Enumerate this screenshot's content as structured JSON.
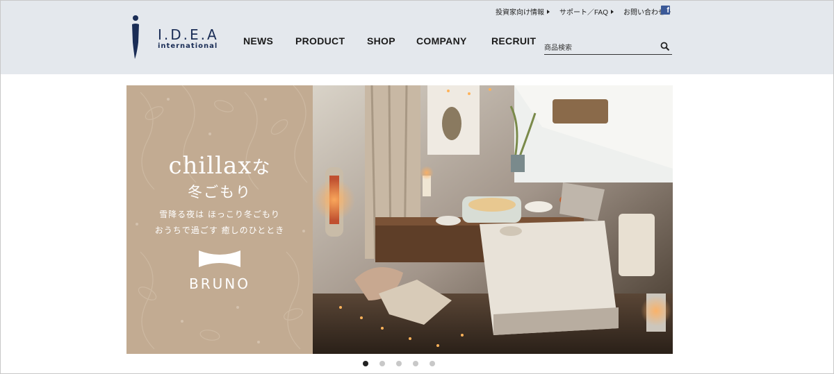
{
  "header": {
    "logo": {
      "main": "I.D.E.A",
      "sub": "international"
    },
    "utility_links": [
      {
        "label": "投資家向け情報"
      },
      {
        "label": "サポート／FAQ"
      },
      {
        "label": "お問い合わせ"
      }
    ],
    "social": {
      "facebook_glyph": "f",
      "icon": "facebook-icon"
    },
    "nav": {
      "news": "NEWS",
      "product": "PRODUCT",
      "shop": "SHOP",
      "company": "COMPANY",
      "recruit": "RECRUIT"
    },
    "search": {
      "placeholder": "商品検索",
      "icon": "search-icon"
    }
  },
  "banner": {
    "title_main": "chillax",
    "title_suffix": "な",
    "subtitle": "冬ごもり",
    "copy_line1": "雪降る夜は ほっこり冬ごもり",
    "copy_line2": "おうちで過ごす 癒しのひととき",
    "brand": "BRUNO",
    "colors": {
      "left_panel": "#c2ab92",
      "header_bg": "#e4e8ed",
      "logo_navy": "#1a2d56"
    }
  },
  "carousel": {
    "slides": [
      {
        "active": true
      },
      {
        "active": false
      },
      {
        "active": false
      },
      {
        "active": false
      },
      {
        "active": false
      }
    ]
  }
}
